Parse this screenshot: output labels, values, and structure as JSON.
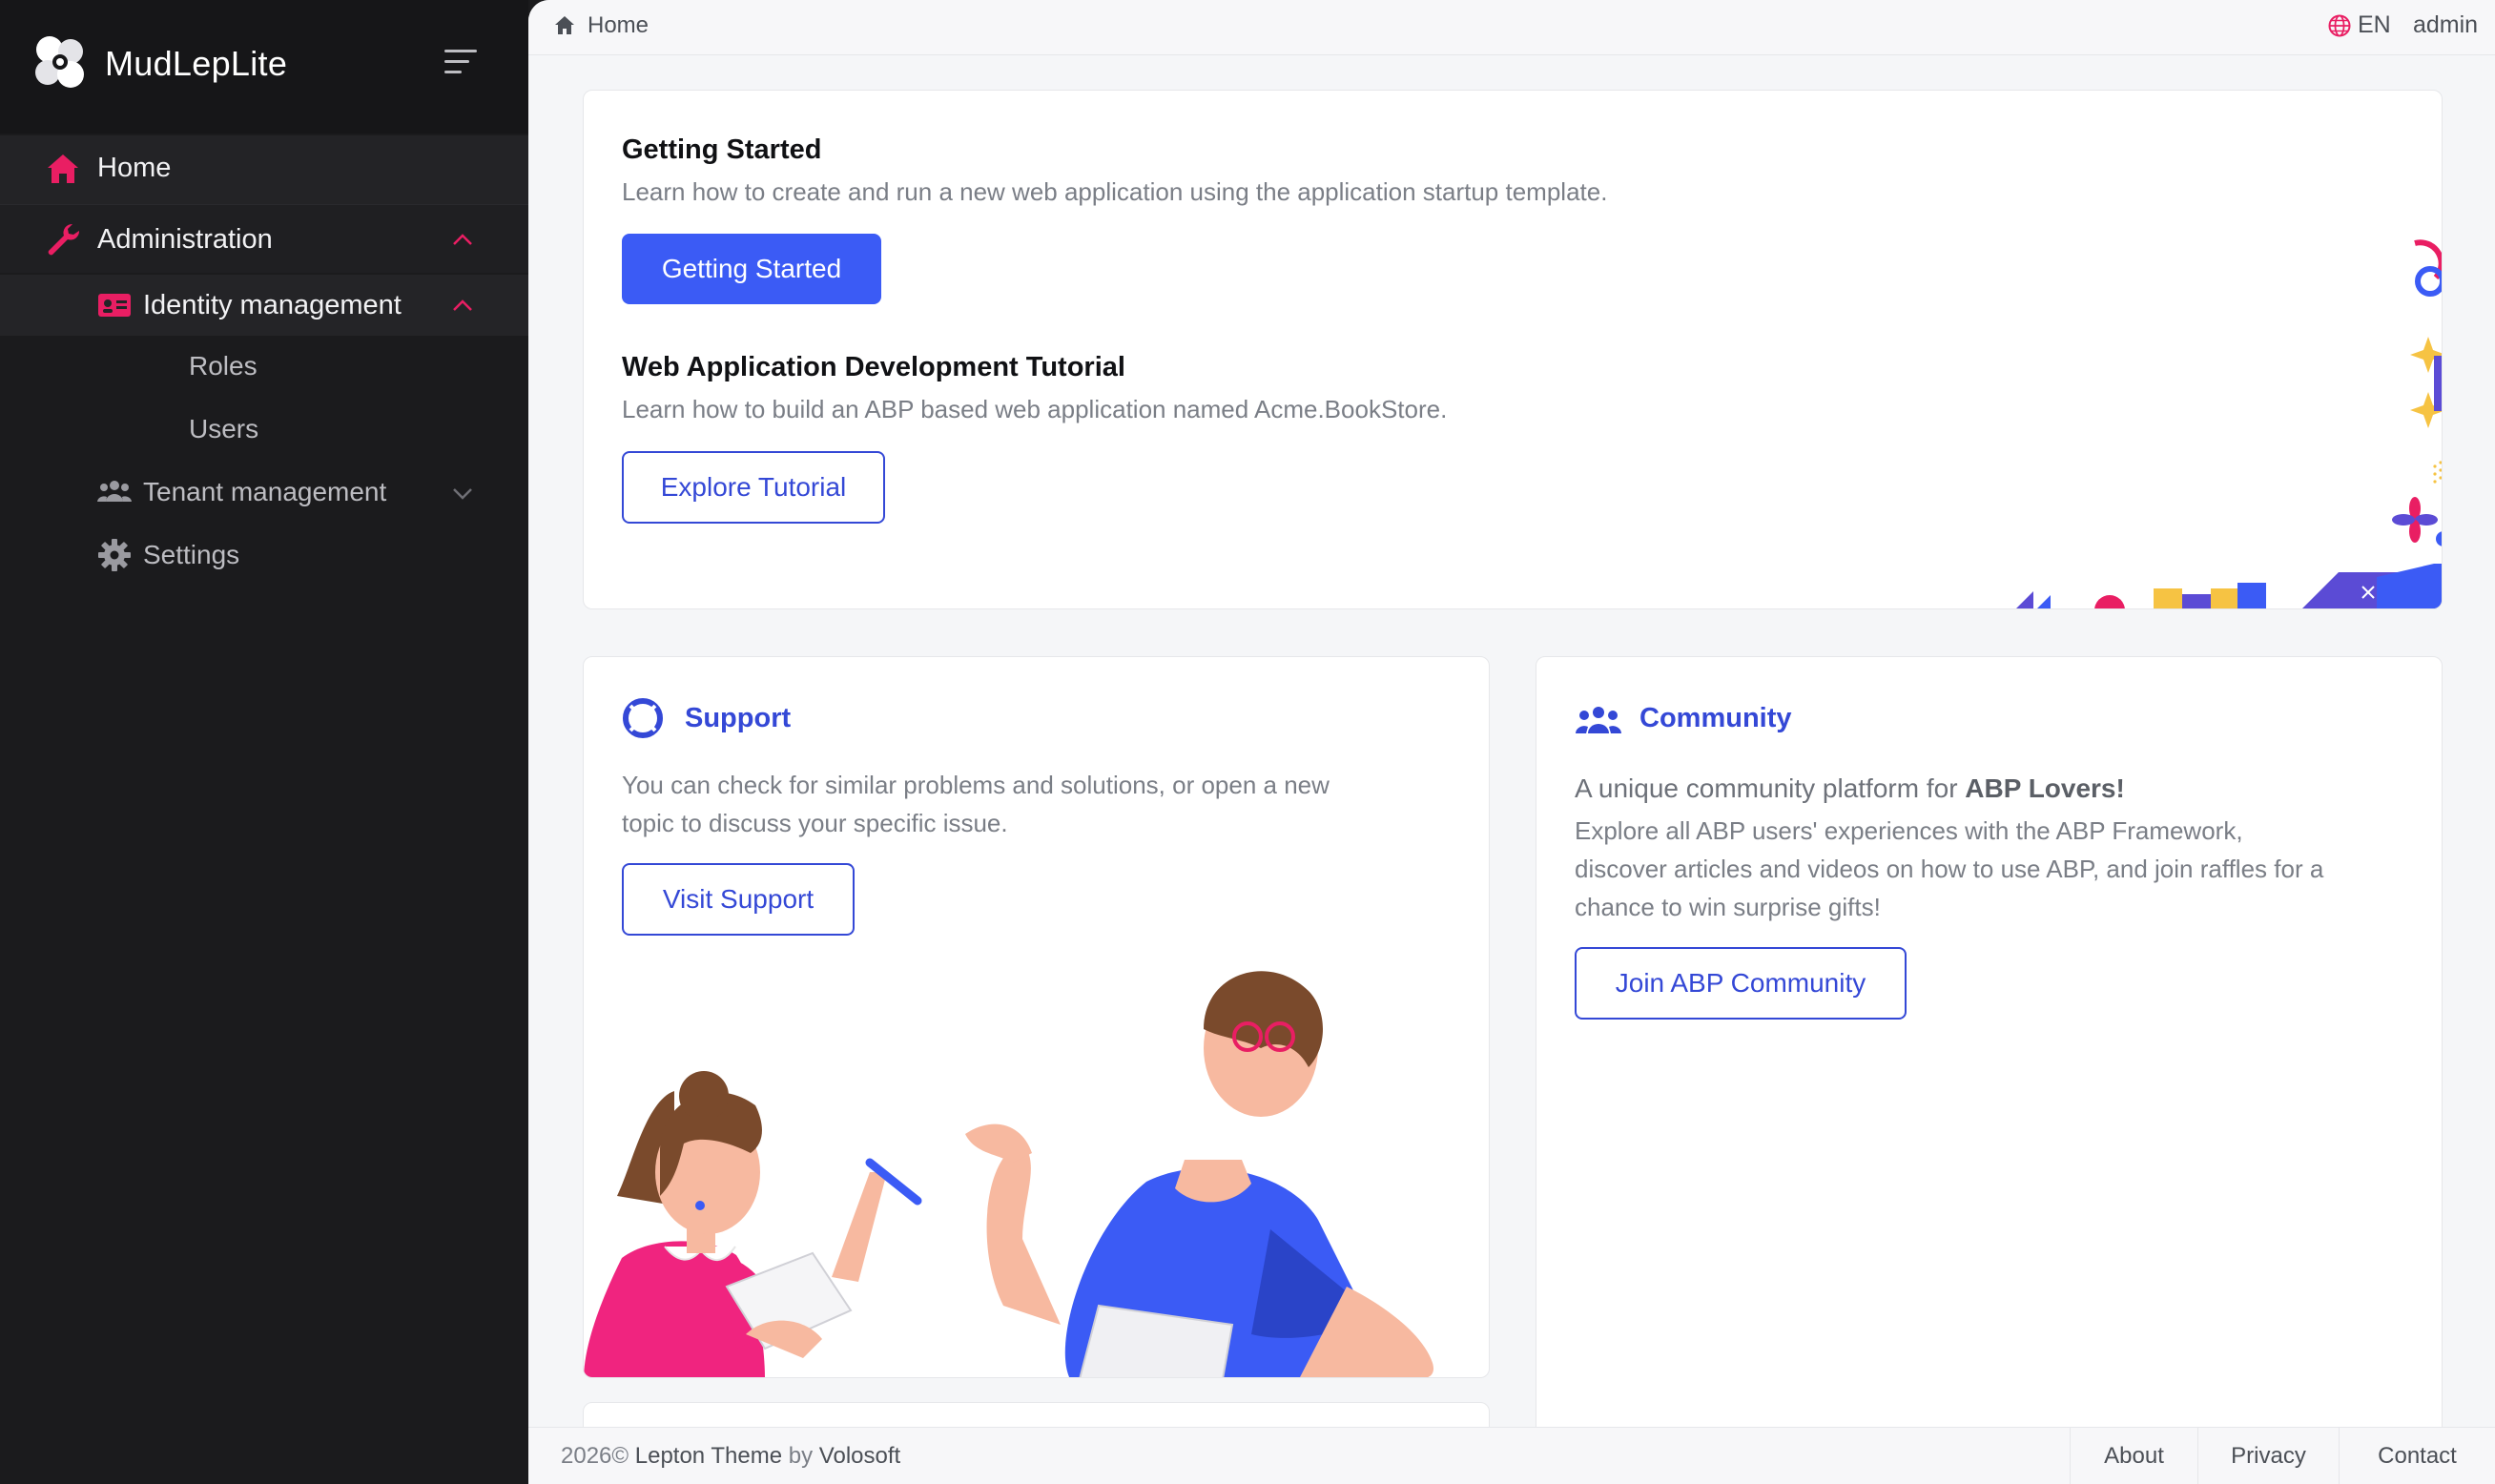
{
  "brand": {
    "name": "MudLepLite"
  },
  "colors": {
    "accent": "#e91e63",
    "primary": "#3b5bf5",
    "link": "#3448d6",
    "sidebar_bg": "#1b1b1d"
  },
  "sidebar": {
    "items": [
      {
        "label": "Home",
        "icon": "home-icon",
        "active": true
      },
      {
        "label": "Administration",
        "icon": "wrench-icon",
        "expanded": true
      },
      {
        "label": "Identity management",
        "icon": "id-card-icon",
        "expanded": true
      },
      {
        "label": "Roles"
      },
      {
        "label": "Users"
      },
      {
        "label": "Tenant management",
        "icon": "users-group-icon",
        "expanded": false
      },
      {
        "label": "Settings",
        "icon": "gear-icon"
      }
    ]
  },
  "topbar": {
    "breadcrumb": "Home",
    "language": "EN",
    "user": "admin"
  },
  "getting_started": {
    "title": "Getting Started",
    "description": "Learn how to create and run a new web application using the application startup template.",
    "button": "Getting Started",
    "tutorial_title": "Web Application Development Tutorial",
    "tutorial_description": "Learn how to build an ABP based web application named Acme.BookStore.",
    "tutorial_button": "Explore Tutorial"
  },
  "support": {
    "title": "Support",
    "description_line1": "You can check for similar problems and solutions, or open a new",
    "description_line2": "topic to discuss your specific issue.",
    "button": "Visit Support"
  },
  "community": {
    "title": "Community",
    "lead": "A unique community platform for ",
    "lead_bold": "ABP Lovers!",
    "description_line1": "Explore all ABP users' experiences with the ABP Framework,",
    "description_line2": "discover articles and videos on how to use ABP, and join raffles for a",
    "description_line3": "chance to win surprise gifts!",
    "button": "Join ABP Community"
  },
  "footer": {
    "year": "2026©",
    "theme": "Lepton Theme",
    "by": "by",
    "company": "Volosoft",
    "links": [
      "About",
      "Privacy",
      "Contact"
    ]
  }
}
